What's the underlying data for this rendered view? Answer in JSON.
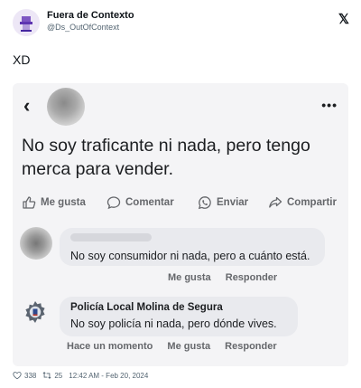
{
  "tweet": {
    "author_name": "Fuera de Contexto",
    "author_handle": "@Ds_OutOfContext",
    "logo": "𝕏",
    "text": "XD"
  },
  "screenshot": {
    "back_icon": "‹",
    "more_icon": "•••",
    "post_text": "No soy traficante ni nada, pero tengo merca para vender.",
    "actions": {
      "like": "Me gusta",
      "comment": "Comentar",
      "send": "Enviar",
      "share": "Compartir"
    },
    "comment1": {
      "text": "No soy consumidor ni nada, pero a cuánto está.",
      "like": "Me gusta",
      "reply": "Responder"
    },
    "comment2": {
      "author": "Policía Local Molina de Segura",
      "text": "No soy policía ni nada, pero dónde vives.",
      "time": "Hace un momento",
      "like": "Me gusta",
      "reply": "Responder"
    }
  },
  "footer": {
    "likes": "338",
    "retweets": "25",
    "timestamp": "12:42 AM - Feb 20, 2024"
  },
  "colors": {
    "fb_text": "#1c1e21",
    "fb_secondary": "#65676b",
    "bubble": "#e9eaee",
    "twitter_gray": "#536471"
  }
}
